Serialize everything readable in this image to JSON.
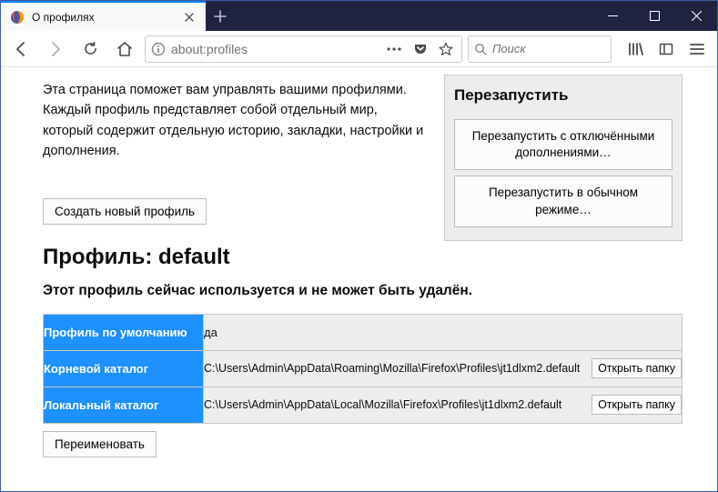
{
  "window": {
    "tab_title": "О профилях"
  },
  "urlbar": {
    "text": "about:profiles"
  },
  "search": {
    "placeholder": "Поиск"
  },
  "page": {
    "intro": "Эта страница поможет вам управлять вашими профилями. Каждый профиль представляет собой отдельный мир, который содержит отдельную историю, закладки, настройки и дополнения.",
    "create_button": "Создать новый профиль",
    "restart": {
      "title": "Перезапустить",
      "restart_addons_disabled": "Перезапустить с отключёнными дополнениями…",
      "restart_normal": "Перезапустить в обычном режиме…"
    },
    "profile": {
      "title": "Профиль: default",
      "in_use_msg": "Этот профиль сейчас используется и не может быть удалён.",
      "rows": {
        "default_label": "Профиль по умолчанию",
        "default_value": "да",
        "root_label": "Корневой каталог",
        "root_value": "C:\\Users\\Admin\\AppData\\Roaming\\Mozilla\\Firefox\\Profiles\\jt1dlxm2.default",
        "local_label": "Локальный каталог",
        "local_value": "C:\\Users\\Admin\\AppData\\Local\\Mozilla\\Firefox\\Profiles\\jt1dlxm2.default",
        "open_folder": "Открыть папку"
      },
      "rename_button": "Переименовать"
    }
  }
}
